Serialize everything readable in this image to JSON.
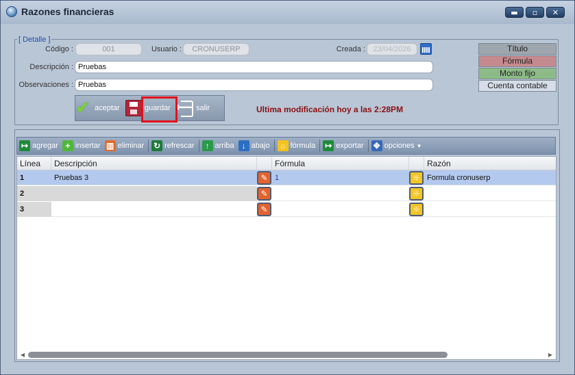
{
  "window": {
    "title": "Razones financieras",
    "controls": {
      "minimize": "▬",
      "maximize": "▫",
      "close": "✕"
    }
  },
  "detail": {
    "legend": "[ Detalle ]",
    "codigo_label": "Código :",
    "codigo_value": "001",
    "usuario_label": "Usuario :",
    "usuario_value": "CRONUSERP",
    "creada_label": "Creada :",
    "creada_value": "23/04/2026",
    "descripcion_label": "Descripción :",
    "descripcion_value": "Pruebas",
    "observaciones_label": "Observaciones :",
    "observaciones_value": "Pruebas"
  },
  "legend_boxes": [
    {
      "label": "Título",
      "color": "#9fa6ad"
    },
    {
      "label": "Fórmula",
      "color": "#c58a8e"
    },
    {
      "label": "Monto fijo",
      "color": "#8dbb87"
    },
    {
      "label": "Cuenta contable",
      "color": "#d6dde8"
    }
  ],
  "actions": {
    "aceptar": "aceptar",
    "guardar": "guardar",
    "salir": "salir"
  },
  "last_modified": "Ultima modificación hoy a las   2:28PM",
  "toolbar": {
    "agregar": "agregar",
    "insertar": "insertar",
    "eliminar": "eliminar",
    "refrescar": "refrescar",
    "arriba": "arriba",
    "abajo": "abajo",
    "formula": "fórmula",
    "exportar": "exportar",
    "opciones": "opciones"
  },
  "table": {
    "headers": [
      "Línea",
      "Descripción",
      "Fórmula",
      "Razón"
    ],
    "rows": [
      {
        "linea": "1",
        "descripcion": "Pruebas 3",
        "formula": "1",
        "razon": "Formula cronuserp"
      },
      {
        "linea": "2",
        "descripcion": "",
        "formula": "",
        "razon": ""
      },
      {
        "linea": "3",
        "descripcion": "",
        "formula": "",
        "razon": ""
      }
    ]
  }
}
